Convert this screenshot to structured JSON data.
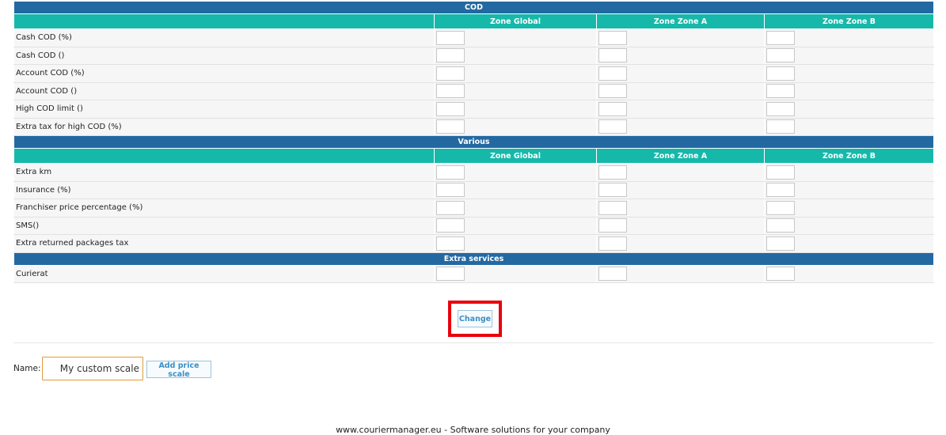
{
  "sections": {
    "cod": {
      "title": "COD",
      "zones": [
        "Zone Global",
        "Zone Zone A",
        "Zone Zone B"
      ],
      "rows": [
        "Cash COD (%)",
        "Cash COD ()",
        "Account COD (%)",
        "Account COD ()",
        "High COD limit ()",
        "Extra tax for high COD (%)"
      ]
    },
    "various": {
      "title": "Various",
      "zones": [
        "Zone Global",
        "Zone Zone A",
        "Zone Zone B"
      ],
      "rows": [
        "Extra km",
        "Insurance (%)",
        "Franchiser price percentage (%)",
        "SMS()",
        "Extra returned packages tax"
      ]
    },
    "extra": {
      "title": "Extra services",
      "rows": [
        "Curierat"
      ]
    }
  },
  "change_button": "Change",
  "name_form": {
    "label": "Name:",
    "value": "My custom scale",
    "add_button": "Add price scale"
  },
  "footer": "www.couriermanager.eu - Software solutions for your company",
  "colors": {
    "section_header": "#2468a2",
    "zone_header": "#16b8aa",
    "highlight": "#e8000d"
  }
}
